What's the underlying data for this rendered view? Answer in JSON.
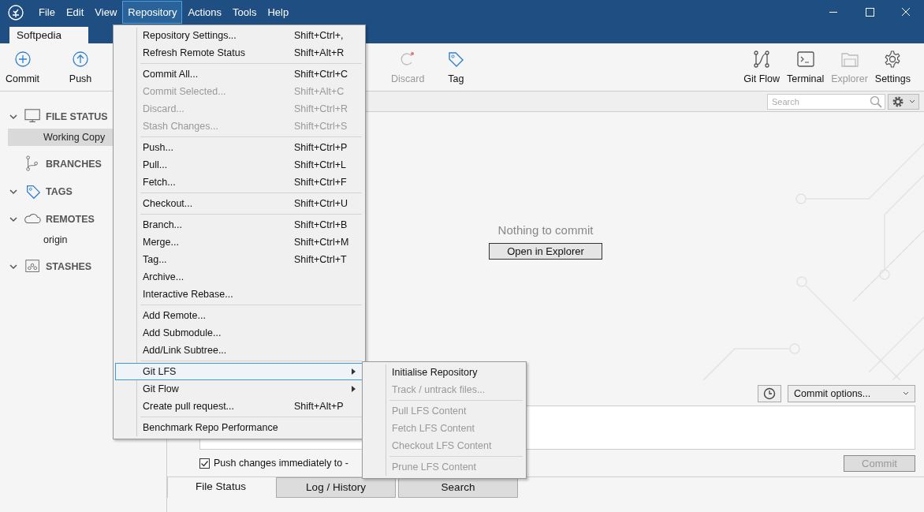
{
  "window": {
    "menu": [
      {
        "label": "File",
        "selected": false
      },
      {
        "label": "Edit",
        "selected": false
      },
      {
        "label": "View",
        "selected": false
      },
      {
        "label": "Repository",
        "selected": true
      },
      {
        "label": "Actions",
        "selected": false
      },
      {
        "label": "Tools",
        "selected": false
      },
      {
        "label": "Help",
        "selected": false
      }
    ]
  },
  "repo_tabs": [
    {
      "label": "Softpedia",
      "selected": true
    }
  ],
  "toolbar": {
    "left": [
      {
        "label": "Commit",
        "disabled": false
      },
      {
        "label": "Push",
        "disabled": false
      }
    ],
    "middle": [
      {
        "label": "Discard",
        "disabled": true
      },
      {
        "label": "Tag",
        "disabled": false
      }
    ],
    "right": [
      {
        "label": "Git Flow",
        "disabled": false
      },
      {
        "label": "Terminal",
        "disabled": false
      },
      {
        "label": "Explorer",
        "disabled": true
      },
      {
        "label": "Settings",
        "disabled": false
      }
    ]
  },
  "sidebar": {
    "sections": [
      {
        "label": "FILE STATUS",
        "kind": "expandable",
        "expanded": true,
        "children": [
          {
            "label": "Working Copy",
            "selected": true
          }
        ]
      },
      {
        "label": "BRANCHES",
        "kind": "plain"
      },
      {
        "label": "TAGS",
        "kind": "expandable",
        "expanded": true
      },
      {
        "label": "REMOTES",
        "kind": "expandable",
        "expanded": true,
        "children": [
          {
            "label": "origin",
            "selected": false
          }
        ]
      },
      {
        "label": "STASHES",
        "kind": "expandable",
        "expanded": true
      }
    ]
  },
  "filter_bar": {
    "search": {
      "placeholder": "Search"
    }
  },
  "content": {
    "message": "Nothing to commit",
    "button": "Open in Explorer"
  },
  "commit_panel": {
    "options": "Commit options...",
    "push_checkbox": {
      "label": "Push changes immediately to -",
      "checked": true
    },
    "commit_button": {
      "label": "Commit",
      "disabled": true
    }
  },
  "bottom_tabs": [
    {
      "label": "File Status",
      "selected": true
    },
    {
      "label": "Log / History",
      "selected": false
    },
    {
      "label": "Search",
      "selected": false
    }
  ],
  "repository_menu": [
    {
      "kind": "item",
      "label": "Repository Settings...",
      "shortcut": "Shift+Ctrl+,",
      "disabled": false,
      "selected": false
    },
    {
      "kind": "item",
      "label": "Refresh Remote Status",
      "shortcut": "Shift+Alt+R",
      "disabled": false,
      "selected": false
    },
    {
      "kind": "separator"
    },
    {
      "kind": "item",
      "label": "Commit All...",
      "shortcut": "Shift+Ctrl+C",
      "disabled": false,
      "selected": false
    },
    {
      "kind": "item",
      "label": "Commit Selected...",
      "shortcut": "Shift+Alt+C",
      "disabled": true,
      "selected": false
    },
    {
      "kind": "item",
      "label": "Discard...",
      "shortcut": "Shift+Ctrl+R",
      "disabled": true,
      "selected": false
    },
    {
      "kind": "item",
      "label": "Stash Changes...",
      "shortcut": "Shift+Ctrl+S",
      "disabled": true,
      "selected": false
    },
    {
      "kind": "separator"
    },
    {
      "kind": "item",
      "label": "Push...",
      "shortcut": "Shift+Ctrl+P",
      "disabled": false,
      "selected": false
    },
    {
      "kind": "item",
      "label": "Pull...",
      "shortcut": "Shift+Ctrl+L",
      "disabled": false,
      "selected": false
    },
    {
      "kind": "item",
      "label": "Fetch...",
      "shortcut": "Shift+Ctrl+F",
      "disabled": false,
      "selected": false
    },
    {
      "kind": "separator"
    },
    {
      "kind": "item",
      "label": "Checkout...",
      "shortcut": "Shift+Ctrl+U",
      "disabled": false,
      "selected": false
    },
    {
      "kind": "separator"
    },
    {
      "kind": "item",
      "label": "Branch...",
      "shortcut": "Shift+Ctrl+B",
      "disabled": false,
      "selected": false
    },
    {
      "kind": "item",
      "label": "Merge...",
      "shortcut": "Shift+Ctrl+M",
      "disabled": false,
      "selected": false
    },
    {
      "kind": "item",
      "label": "Tag...",
      "shortcut": "Shift+Ctrl+T",
      "disabled": false,
      "selected": false
    },
    {
      "kind": "item",
      "label": "Archive...",
      "disabled": false,
      "selected": false
    },
    {
      "kind": "item",
      "label": "Interactive Rebase...",
      "disabled": false,
      "selected": false
    },
    {
      "kind": "separator"
    },
    {
      "kind": "item",
      "label": "Add Remote...",
      "disabled": false,
      "selected": false
    },
    {
      "kind": "item",
      "label": "Add Submodule...",
      "disabled": false,
      "selected": false
    },
    {
      "kind": "item",
      "label": "Add/Link Subtree...",
      "disabled": false,
      "selected": false
    },
    {
      "kind": "separator"
    },
    {
      "kind": "submenu",
      "label": "Git LFS",
      "disabled": false,
      "selected": true
    },
    {
      "kind": "submenu",
      "label": "Git Flow",
      "disabled": false,
      "selected": false
    },
    {
      "kind": "item",
      "label": "Create pull request...",
      "shortcut": "Shift+Alt+P",
      "disabled": false,
      "selected": false
    },
    {
      "kind": "separator"
    },
    {
      "kind": "item",
      "label": "Benchmark Repo Performance",
      "disabled": false,
      "selected": false
    }
  ],
  "lfs_submenu": [
    {
      "kind": "item",
      "label": "Initialise Repository",
      "disabled": false,
      "selected": false
    },
    {
      "kind": "item",
      "label": "Track / untrack files...",
      "disabled": true,
      "selected": false
    },
    {
      "kind": "separator"
    },
    {
      "kind": "item",
      "label": "Pull LFS Content",
      "disabled": true,
      "selected": false
    },
    {
      "kind": "item",
      "label": "Fetch LFS Content",
      "disabled": true,
      "selected": false
    },
    {
      "kind": "item",
      "label": "Checkout LFS Content",
      "disabled": true,
      "selected": false
    },
    {
      "kind": "separator"
    },
    {
      "kind": "item",
      "label": "Prune LFS Content",
      "disabled": true,
      "selected": false
    }
  ]
}
